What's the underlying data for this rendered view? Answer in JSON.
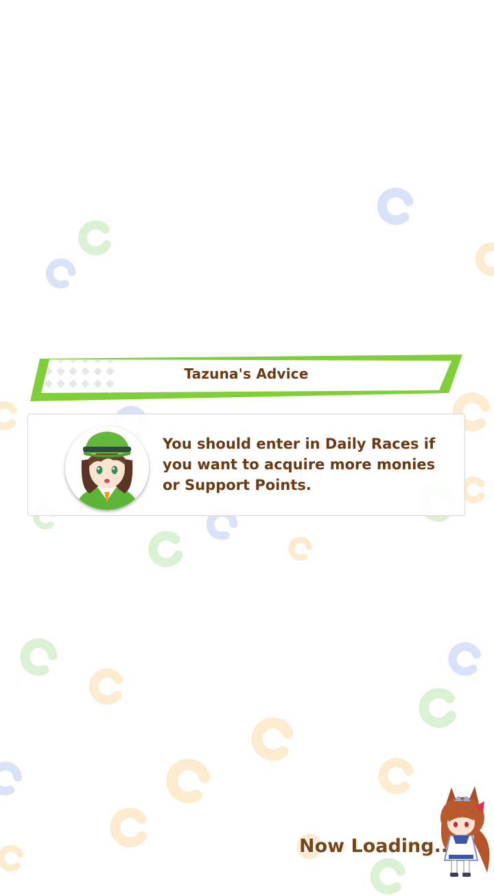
{
  "advice": {
    "title": "Tazuna's Advice",
    "message": "You should enter in Daily Races if you want to acquire more monies or Support Points.",
    "portrait_icon": "tazuna-portrait",
    "accent_color": "#7fce3a"
  },
  "loading": {
    "label": "Now Loading...",
    "mascot_icon": "chibi-horse-girl-icon"
  },
  "background": {
    "pattern_icon": "horseshoe-icon",
    "colors": {
      "green": "#8fd47a",
      "blue": "#8fa6ee",
      "orange": "#f6c36a"
    }
  },
  "colors": {
    "text_brown": "#6b3a14",
    "header_green": "#7fce3a",
    "background": "#ffffff"
  }
}
